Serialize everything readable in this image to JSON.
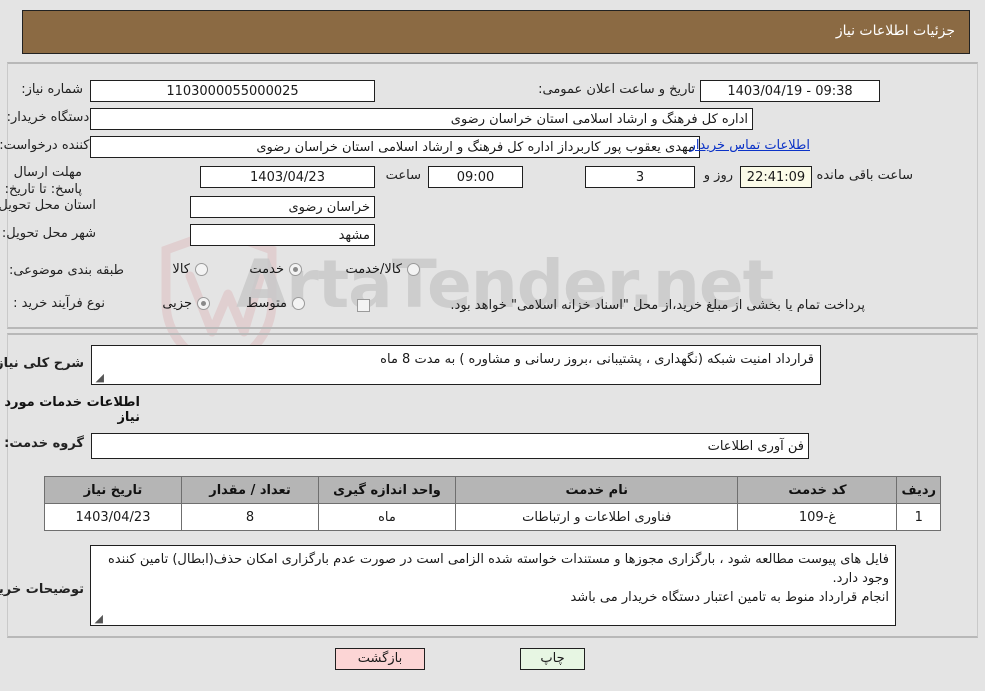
{
  "header": {
    "title": "جزئیات اطلاعات نیاز"
  },
  "need_info": {
    "need_number_label": "شماره نیاز:",
    "need_number_value": "1103000055000025",
    "announce_datetime_label": "تاریخ و ساعت اعلان عمومی:",
    "announce_datetime_value": "09:38 - 1403/04/19",
    "buyer_org_label": "نام دستگاه خریدار:",
    "buyer_org_value": "اداره کل فرهنگ و ارشاد اسلامی استان خراسان رضوی",
    "requester_label": "ایجاد کننده درخواست:",
    "requester_value": "مهدی یعقوب پور کاربرداز اداره کل فرهنگ و ارشاد اسلامی استان خراسان رضوی",
    "buyer_contact_link": "اطلاعات تماس خریدار",
    "deadline_label": "مهلت ارسال پاسخ: تا تاریخ:",
    "deadline_date": "1403/04/23",
    "deadline_hour_label": "ساعت",
    "deadline_hour_value": "09:00",
    "remaining_days": "3",
    "remaining_days_label": "روز و",
    "remaining_time": "22:41:09",
    "remaining_time_label": "ساعت باقی مانده",
    "province_label": "استان محل تحویل:",
    "province_value": "خراسان رضوی",
    "city_label": "شهر محل تحویل:",
    "city_value": "مشهد",
    "classification_label": "طبقه بندی موضوعی:",
    "classification_options": [
      {
        "label": "کالا",
        "selected": false
      },
      {
        "label": "خدمت",
        "selected": true
      },
      {
        "label": "کالا/خدمت",
        "selected": false
      }
    ],
    "process_label": "نوع فرآیند خرید :",
    "process_options": [
      {
        "label": "جزیی",
        "selected": true
      },
      {
        "label": "متوسط",
        "selected": false
      }
    ],
    "treasury_checkbox_checked": false,
    "treasury_checkbox_text": "پرداخت تمام یا بخشی از مبلغ خرید،از محل \"اسناد خزانه اسلامی\" خواهد بود."
  },
  "description": {
    "label": "شرح کلی نیاز:",
    "value": "قرارداد امنیت شبکه (نگهداری ، پشتیبانی ،بروز رسانی و مشاوره ) به مدت 8 ماه"
  },
  "services": {
    "section_title": "اطلاعات خدمات مورد نیاز",
    "group_label": "گروه خدمت:",
    "group_value": "فن آوری اطلاعات",
    "columns": [
      "ردیف",
      "کد خدمت",
      "نام خدمت",
      "واحد اندازه گیری",
      "تعداد / مقدار",
      "تاریخ نیاز"
    ],
    "rows": [
      {
        "row_no": "1",
        "service_code": "غ-109",
        "service_name": "فناوری اطلاعات و ارتباطات",
        "unit": "ماه",
        "quantity": "8",
        "need_date": "1403/04/23"
      }
    ]
  },
  "buyer_notes": {
    "label": "توضیحات خریدار:",
    "lines": [
      "فایل های پیوست مطالعه شود ، بارگزاری مجوزها و مستندات خواسته شده الزامی است در صورت عدم بارگزاری امکان حذف(ابطال) تامین کننده وجود دارد.",
      "انجام قرارداد منوط به تامین اعتبار دستگاه خریدار می باشد"
    ]
  },
  "buttons": {
    "back": "بازگشت",
    "print": "چاپ"
  },
  "watermark": {
    "text": "ArtaTender.net"
  },
  "colors": {
    "header_bar": "#8b6a43",
    "page_background": "#e4e4e4",
    "link": "#0c33c7",
    "back_button": "#fcd5d5",
    "print_button": "#e7f6e3",
    "table_header": "#b5b5b5",
    "countdown_field": "#fbfbe8"
  }
}
